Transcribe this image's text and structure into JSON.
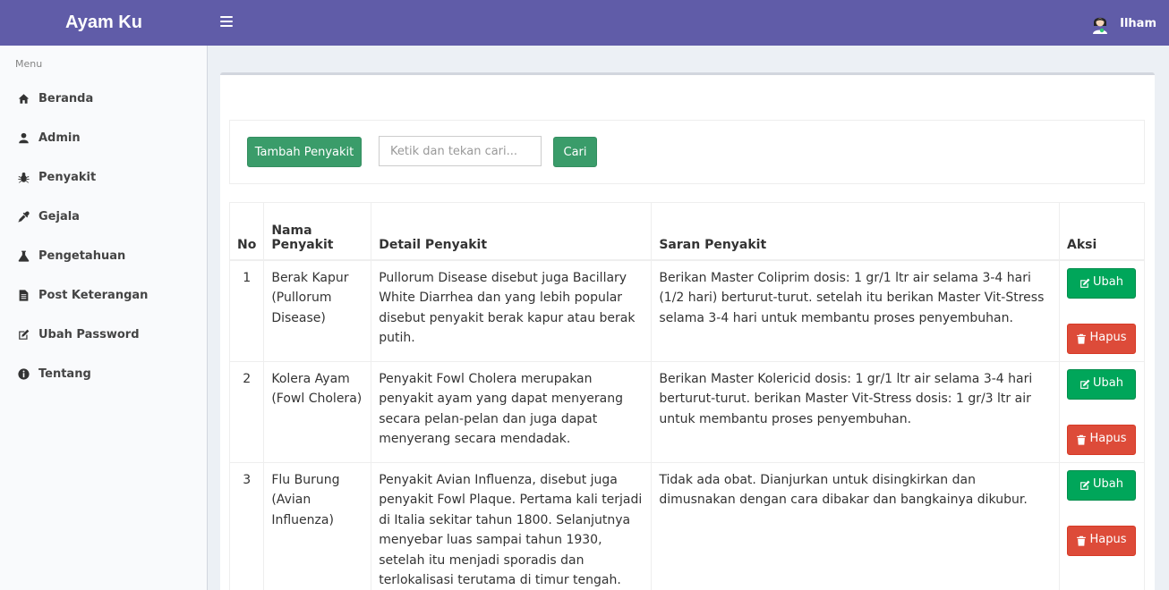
{
  "app": {
    "brand": "Ayam Ku",
    "user_name": "Ilham"
  },
  "sidebar": {
    "header": "Menu",
    "items": [
      {
        "label": "Beranda",
        "icon": "home-icon"
      },
      {
        "label": "Admin",
        "icon": "user-icon"
      },
      {
        "label": "Penyakit",
        "icon": "bug-icon"
      },
      {
        "label": "Gejala",
        "icon": "eyedropper-icon"
      },
      {
        "label": "Pengetahuan",
        "icon": "flask-icon"
      },
      {
        "label": "Post Keterangan",
        "icon": "file-text-icon"
      },
      {
        "label": "Ubah Password",
        "icon": "edit-icon"
      },
      {
        "label": "Tentang",
        "icon": "info-circle-icon"
      }
    ]
  },
  "toolbar": {
    "add_label": "Tambah Penyakit",
    "search_placeholder": "Ketik dan tekan cari...",
    "search_value": "",
    "search_button": "Cari"
  },
  "table": {
    "headers": {
      "no": "No",
      "name": "Nama Penyakit",
      "detail": "Detail Penyakit",
      "saran": "Saran Penyakit",
      "aksi": "Aksi"
    },
    "edit_label": "Ubah",
    "delete_label": "Hapus",
    "rows": [
      {
        "no": "1",
        "name": "Berak Kapur (Pullorum Disease)",
        "detail": "Pullorum Disease disebut juga Bacillary White Diarrhea dan yang lebih popular disebut penyakit berak kapur atau berak putih.",
        "saran": "Berikan Master Coliprim dosis: 1 gr/1 ltr air selama 3-4 hari (1/2 hari) berturut-turut. setelah itu berikan Master Vit-Stress selama 3-4 hari untuk membantu proses penyembuhan."
      },
      {
        "no": "2",
        "name": "Kolera Ayam (Fowl Cholera)",
        "detail": "Penyakit Fowl Cholera merupakan penyakit ayam yang dapat menyerang secara pelan-pelan dan juga dapat menyerang secara mendadak.",
        "saran": "Berikan Master Kolericid dosis: 1 gr/1 ltr air selama 3-4 hari berturut-turut. berikan Master Vit-Stress dosis: 1 gr/3 ltr air untuk membantu proses penyembuhan."
      },
      {
        "no": "3",
        "name": "Flu Burung (Avian Influenza)",
        "detail": "Penyakit Avian Influenza, disebut juga penyakit Fowl Plaque. Pertama kali terjadi di Italia sekitar tahun 1800. Selanjutnya menyebar luas sampai tahun 1930, setelah itu menjadi sporadis dan terlokalisasi terutama di timur tengah.",
        "saran": "Tidak ada obat. Dianjurkan untuk disingkirkan dan dimusnakan dengan cara dibakar dan bangkainya dikubur."
      }
    ]
  }
}
